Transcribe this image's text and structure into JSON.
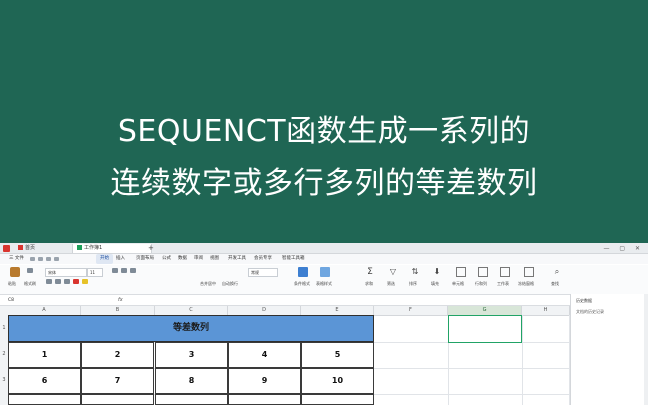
{
  "banner": {
    "line1": "SEQUENCT函数生成一系列的",
    "line2": "连续数字或多行多列的等差数列",
    "background": "#1f6654"
  },
  "titlebar": {
    "tab_home": "首页",
    "tab_file": "工作簿1"
  },
  "menubar": {
    "file": "三 文件",
    "items": [
      "开始",
      "插入",
      "页面布局",
      "公式",
      "数据",
      "审阅",
      "视图",
      "开发工具",
      "会员专享",
      "智能工具箱"
    ]
  },
  "ribbon": {
    "font_name": "宋体",
    "font_size": "11",
    "labels": [
      "格式刷",
      "粘贴",
      "合并居中",
      "自动换行",
      "常规",
      "条件格式",
      "表格样式",
      "求和",
      "筛选",
      "排序",
      "填充",
      "单元格",
      "行和列",
      "工作表",
      "冻结窗格",
      "查找"
    ]
  },
  "formula": {
    "cell_ref": "C8",
    "fx": "fx"
  },
  "sidepanel": {
    "title": "历史数据",
    "subtitle": "文档的历史记录"
  },
  "sheet": {
    "columns": [
      "A",
      "B",
      "C",
      "D",
      "E",
      "F",
      "G",
      "H"
    ],
    "selected_column": "G",
    "rows": [
      "1",
      "2",
      "3"
    ],
    "table_title": "等差数列",
    "values": [
      [
        "1",
        "2",
        "3",
        "4",
        "5"
      ],
      [
        "6",
        "7",
        "8",
        "9",
        "10"
      ]
    ]
  }
}
